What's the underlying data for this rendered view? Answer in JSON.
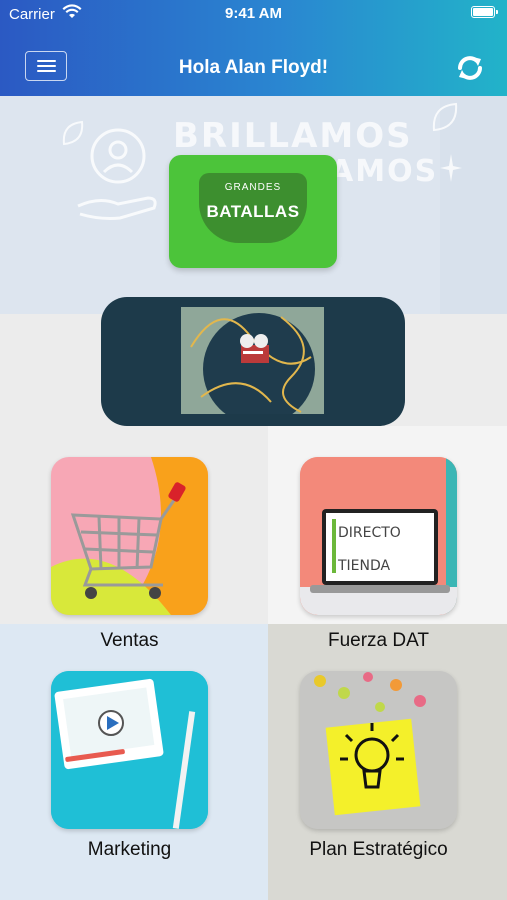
{
  "status_bar": {
    "carrier": "Carrier",
    "time": "9:41 AM"
  },
  "header": {
    "title": "Hola Alan Floyd!",
    "menu_icon": "hamburger-menu-icon",
    "refresh_icon": "refresh-icon"
  },
  "banner": {
    "background_words": [
      "BRILLAMOS",
      "AMOS"
    ],
    "card_small_text": "GRANDES",
    "card_big_text": "BATALLAS"
  },
  "video_card": {
    "icon": "film-reel-icon"
  },
  "tiles": [
    {
      "label": "Ventas",
      "icon": "shopping-cart-icon"
    },
    {
      "label": "Fuerza DAT",
      "icon": "laptop-icon",
      "screen_rows": [
        "DIRECTO",
        "TIENDA"
      ]
    },
    {
      "label": "Marketing",
      "icon": "video-player-icon"
    },
    {
      "label": "Plan Estratégico",
      "icon": "lightbulb-icon"
    }
  ],
  "colors": {
    "header_start": "#2b59c3",
    "header_end": "#22b3c9",
    "grandes_green": "#4cc43a",
    "video_navy": "#1d3a4a"
  }
}
